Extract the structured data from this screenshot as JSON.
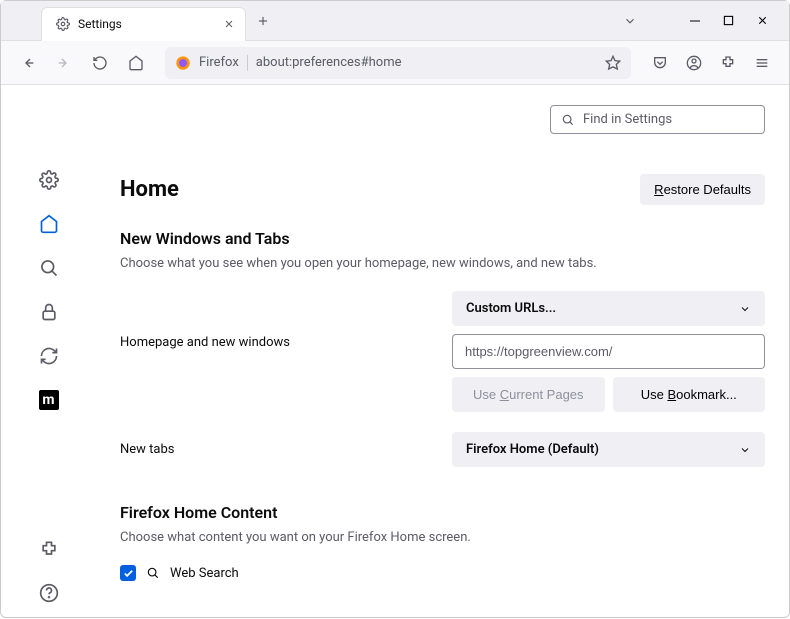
{
  "tab": {
    "title": "Settings"
  },
  "urlbar": {
    "brand": "Firefox",
    "address": "about:preferences#home"
  },
  "search": {
    "placeholder": "Find in Settings"
  },
  "page": {
    "heading": "Home",
    "restore": "estore Defaults",
    "section1_title": "New Windows and Tabs",
    "section1_desc": "Choose what you see when you open your homepage, new windows, and new tabs.",
    "homepage_label": "Homepage and new windows",
    "homepage_select": "Custom URLs...",
    "homepage_url": "https://topgreenview.com/",
    "use_current": "urrent Pages",
    "use_bookmark": "ookmark...",
    "newtabs_label": "New tabs",
    "newtabs_select": "Firefox Home (Default)",
    "section2_title": "Firefox Home Content",
    "section2_desc": "Choose what content you want on your Firefox Home screen.",
    "websearch": "Web Search"
  }
}
